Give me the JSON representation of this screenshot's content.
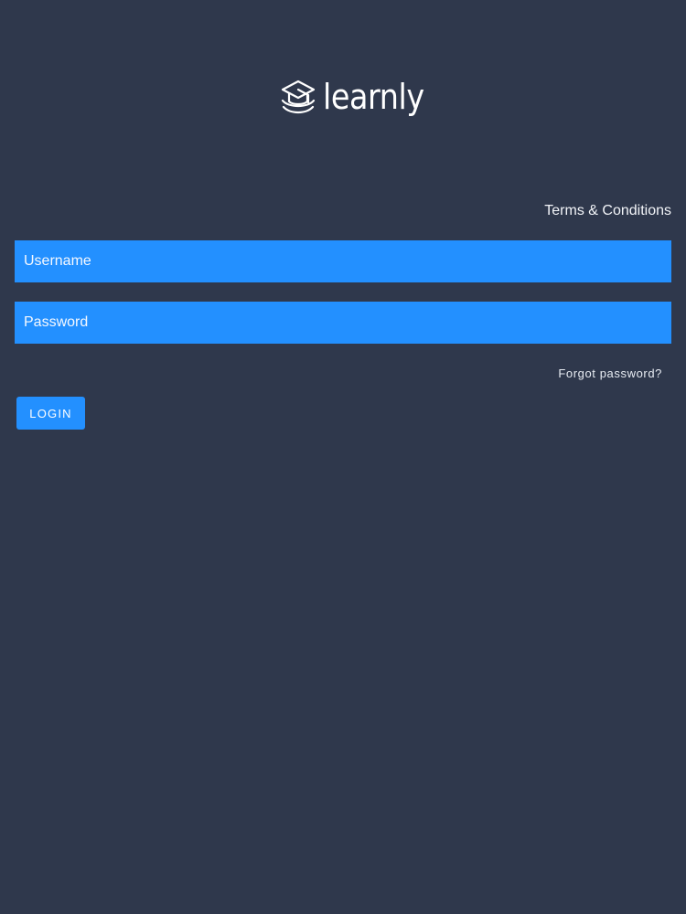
{
  "brand": {
    "name": "learnly",
    "icon": "graduation-cap-icon"
  },
  "links": {
    "terms": "Terms & Conditions",
    "forgot_password": "Forgot password?"
  },
  "form": {
    "username": {
      "value": "",
      "placeholder": "Username"
    },
    "password": {
      "value": "",
      "placeholder": "Password"
    },
    "login_label": "LOGIN"
  },
  "colors": {
    "background": "#2f384c",
    "accent": "#2390ff",
    "text": "#ffffff"
  }
}
